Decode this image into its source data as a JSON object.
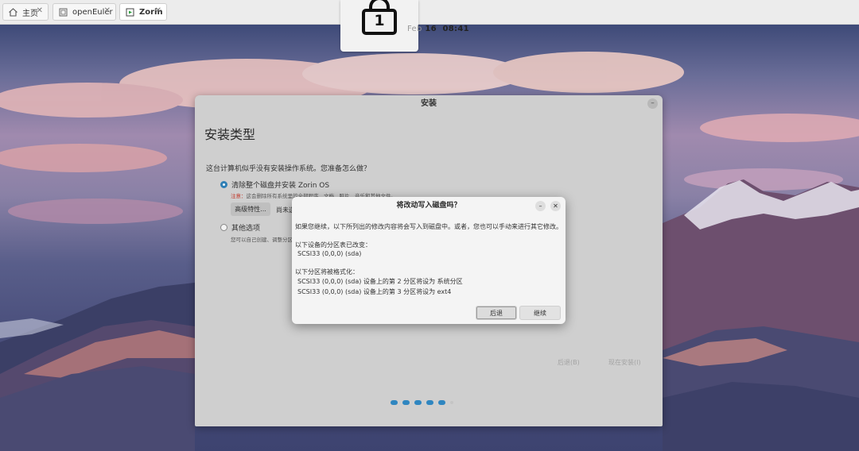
{
  "browser": {
    "tabs": [
      {
        "label": "主页",
        "icon": "home-icon"
      },
      {
        "label": "openEuler",
        "icon": "vm-icon"
      },
      {
        "label": "Zorin",
        "icon": "vm-run-icon"
      }
    ]
  },
  "lock": {
    "number": "1"
  },
  "clock": {
    "date": "Feb",
    "day": "16",
    "time": "08:41"
  },
  "installer": {
    "title": "安装",
    "minimize": "–",
    "heading": "安装类型",
    "question": "这台计算机似乎没有安装操作系统。您准备怎么做？",
    "option_erase": "清除整个磁盘并安装 Zorin OS",
    "warning_label": "注意：",
    "warning_text": "这会删除所有系统里的全部程序、文档、照片、音乐和其他文件。",
    "advanced_button": "高级特性...",
    "advanced_note": "尚未选择",
    "option_other": "其他选项",
    "other_note": "您可以自己创建、调整分区，或者为 Zorin OS 选择多个分区。",
    "back": "后退(B)",
    "install_now": "现在安装(I)"
  },
  "dialog": {
    "title": "将改动写入磁盘吗？",
    "minimize": "–",
    "close": "✕",
    "intro": "如果您继续，以下所列出的修改内容将会写入到磁盘中。或者，您也可以手动来进行其它修改。",
    "changed_header": "以下设备的分区表已改变：",
    "changed_device": "SCSI33 (0,0,0) (sda)",
    "format_header": "以下分区将被格式化：",
    "format_1": "SCSI33 (0,0,0) (sda) 设备上的第 2 分区将设为 系统分区",
    "format_2": "SCSI33 (0,0,0) (sda) 设备上的第 3 分区将设为 ext4",
    "back_button": "后退",
    "continue_button": "继续"
  }
}
